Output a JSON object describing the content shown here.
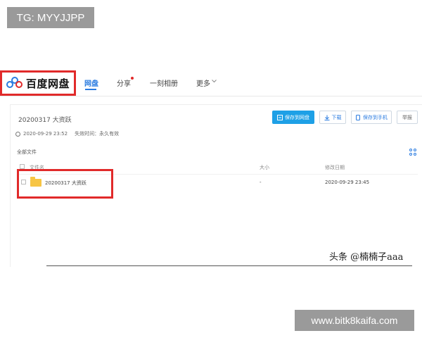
{
  "watermark_top": "TG: MYYJJPP",
  "watermark_bottom": "www.bitk8kaifa.com",
  "brand": {
    "name": "百度网盘"
  },
  "nav": [
    {
      "label": "网盘",
      "active": true
    },
    {
      "label": "分享",
      "active": false
    },
    {
      "label": "一刻相册",
      "active": false
    },
    {
      "label": "更多",
      "active": false
    }
  ],
  "share": {
    "title": "20200317 大资跃",
    "time": "2020-09-29 23:52",
    "expiry": "失效时间：永久有效"
  },
  "buttons": {
    "save": "保存到网盘",
    "download": "下载",
    "save_phone": "保存到手机",
    "report": "举报"
  },
  "breadcrumb": "全部文件",
  "table": {
    "headers": [
      "文件名",
      "大小",
      "修改日期"
    ],
    "rows": [
      {
        "name": "20200317 大资跃",
        "size": "-",
        "date": "2020-09-29 23:45"
      }
    ]
  },
  "author": "头条 @楠楠子aaa",
  "colors": {
    "accent": "#2a7be0",
    "primary_button": "#1ea0e6",
    "highlight": "#e12a2a",
    "folder": "#f7c544"
  },
  "icons": [
    "baidu-logo-icon",
    "clock-icon",
    "save-icon",
    "download-icon",
    "phone-icon",
    "grid-view-icon",
    "folder-icon",
    "chevron-down-icon"
  ]
}
